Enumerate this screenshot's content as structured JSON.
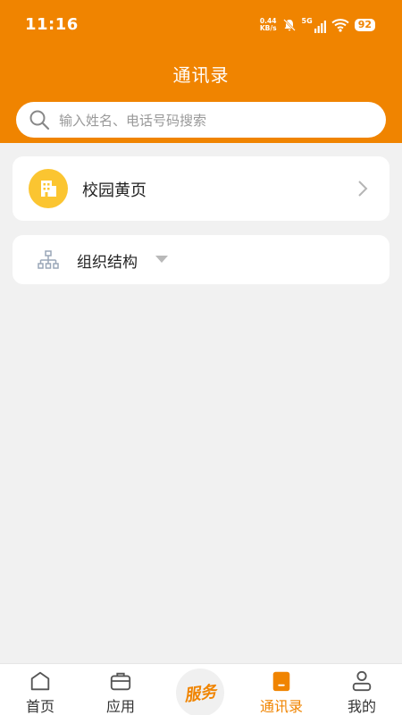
{
  "status": {
    "time": "11:16",
    "net_speed_value": "0.44",
    "net_speed_unit": "KB/s",
    "network": "5G",
    "battery": "92"
  },
  "header": {
    "title": "通讯录"
  },
  "search": {
    "placeholder": "输入姓名、电话号码搜索"
  },
  "directory": {
    "yellow_pages_label": "校园黄页",
    "org_structure_label": "组织结构"
  },
  "tabbar": {
    "items": [
      {
        "label": "首页",
        "icon": "home-icon"
      },
      {
        "label": "应用",
        "icon": "briefcase-icon"
      },
      {
        "label": "服务",
        "icon": "service-icon"
      },
      {
        "label": "通讯录",
        "icon": "contacts-book-icon",
        "active": true
      },
      {
        "label": "我的",
        "icon": "person-icon"
      }
    ],
    "accent": "#f08400"
  },
  "colors": {
    "accent": "#f08400",
    "background": "#f1f1f1",
    "yellow_icon": "#fbc531"
  }
}
